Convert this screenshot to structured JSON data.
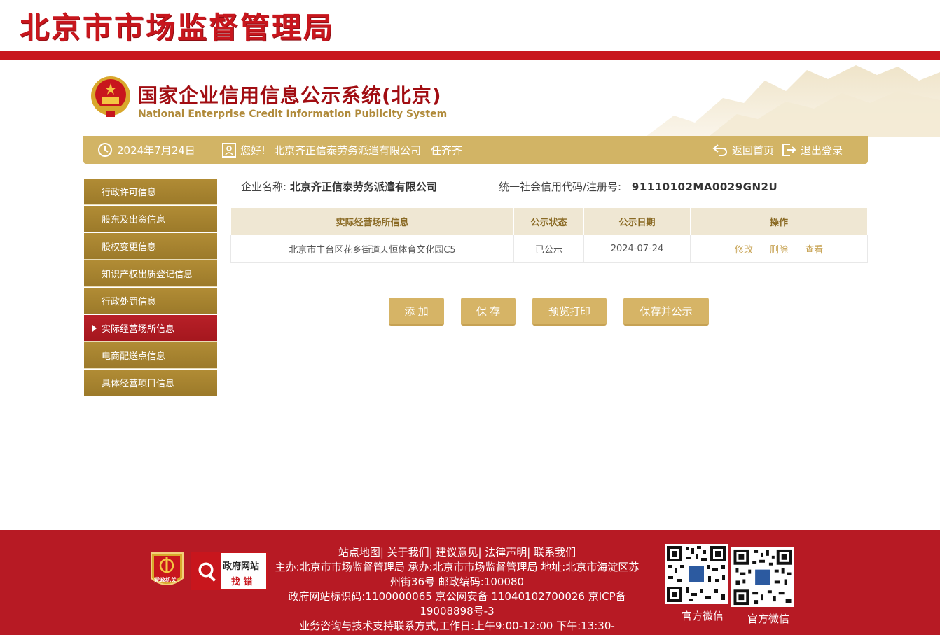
{
  "header": {
    "agency_title": "北京市市场监督管理局",
    "system_title_cn": "国家企业信用信息公示系统(北京)",
    "system_title_en": "National Enterprise Credit Information Publicity System"
  },
  "topbar": {
    "date": "2024年7月24日",
    "greeting": "您好!",
    "company": "北京齐正信泰劳务派遣有限公司",
    "user": "任齐齐",
    "home_label": "返回首页",
    "logout_label": "退出登录"
  },
  "sidebar": {
    "items": [
      {
        "label": "行政许可信息"
      },
      {
        "label": "股东及出资信息"
      },
      {
        "label": "股权变更信息"
      },
      {
        "label": "知识产权出质登记信息"
      },
      {
        "label": "行政处罚信息"
      },
      {
        "label": "实际经营场所信息"
      },
      {
        "label": "电商配送点信息"
      },
      {
        "label": "具体经营项目信息"
      }
    ],
    "active_index": 5
  },
  "company_info": {
    "name_label": "企业名称:",
    "name_value": "北京齐正信泰劳务派遣有限公司",
    "code_label": "统一社会信用代码/注册号:",
    "code_value": "91110102MA0029GN2U"
  },
  "table": {
    "headers": [
      "实际经营场所信息",
      "公示状态",
      "公示日期",
      "操作"
    ],
    "rows": [
      {
        "address": "北京市丰台区花乡街道天恒体育文化园C5",
        "status": "已公示",
        "date": "2024-07-24",
        "actions": [
          "修改",
          "删除",
          "查看"
        ]
      }
    ]
  },
  "buttons": {
    "add": "添 加",
    "save": "保 存",
    "preview_print": "预览打印",
    "save_publish": "保存并公示"
  },
  "footer": {
    "links": "站点地图| 关于我们| 建议意见| 法律声明| 联系我们",
    "line1": "主办:北京市市场监督管理局 承办:北京市市场监督管理局 地址:北京市海淀区苏州街36号 邮政编码:100080",
    "line2": "政府网站标识码:1100000065   京公网安备 11040102700026   京ICP备19008898号-3",
    "line3": "业务咨询与技术支持联系方式,工作日:上午9:00-12:00 下午:13:30-",
    "party_badge": "党政机关",
    "gov_badge_title": "政府网站",
    "gov_badge_sub": "找 错",
    "qr1_label": "官方微信",
    "qr2_label": "官方微信"
  },
  "colors": {
    "brand_red": "#c8161d",
    "gold": "#d2b465",
    "sidebar_gold": "#a8842f",
    "active_red": "#b01c24",
    "footer_red": "#b71a24"
  }
}
